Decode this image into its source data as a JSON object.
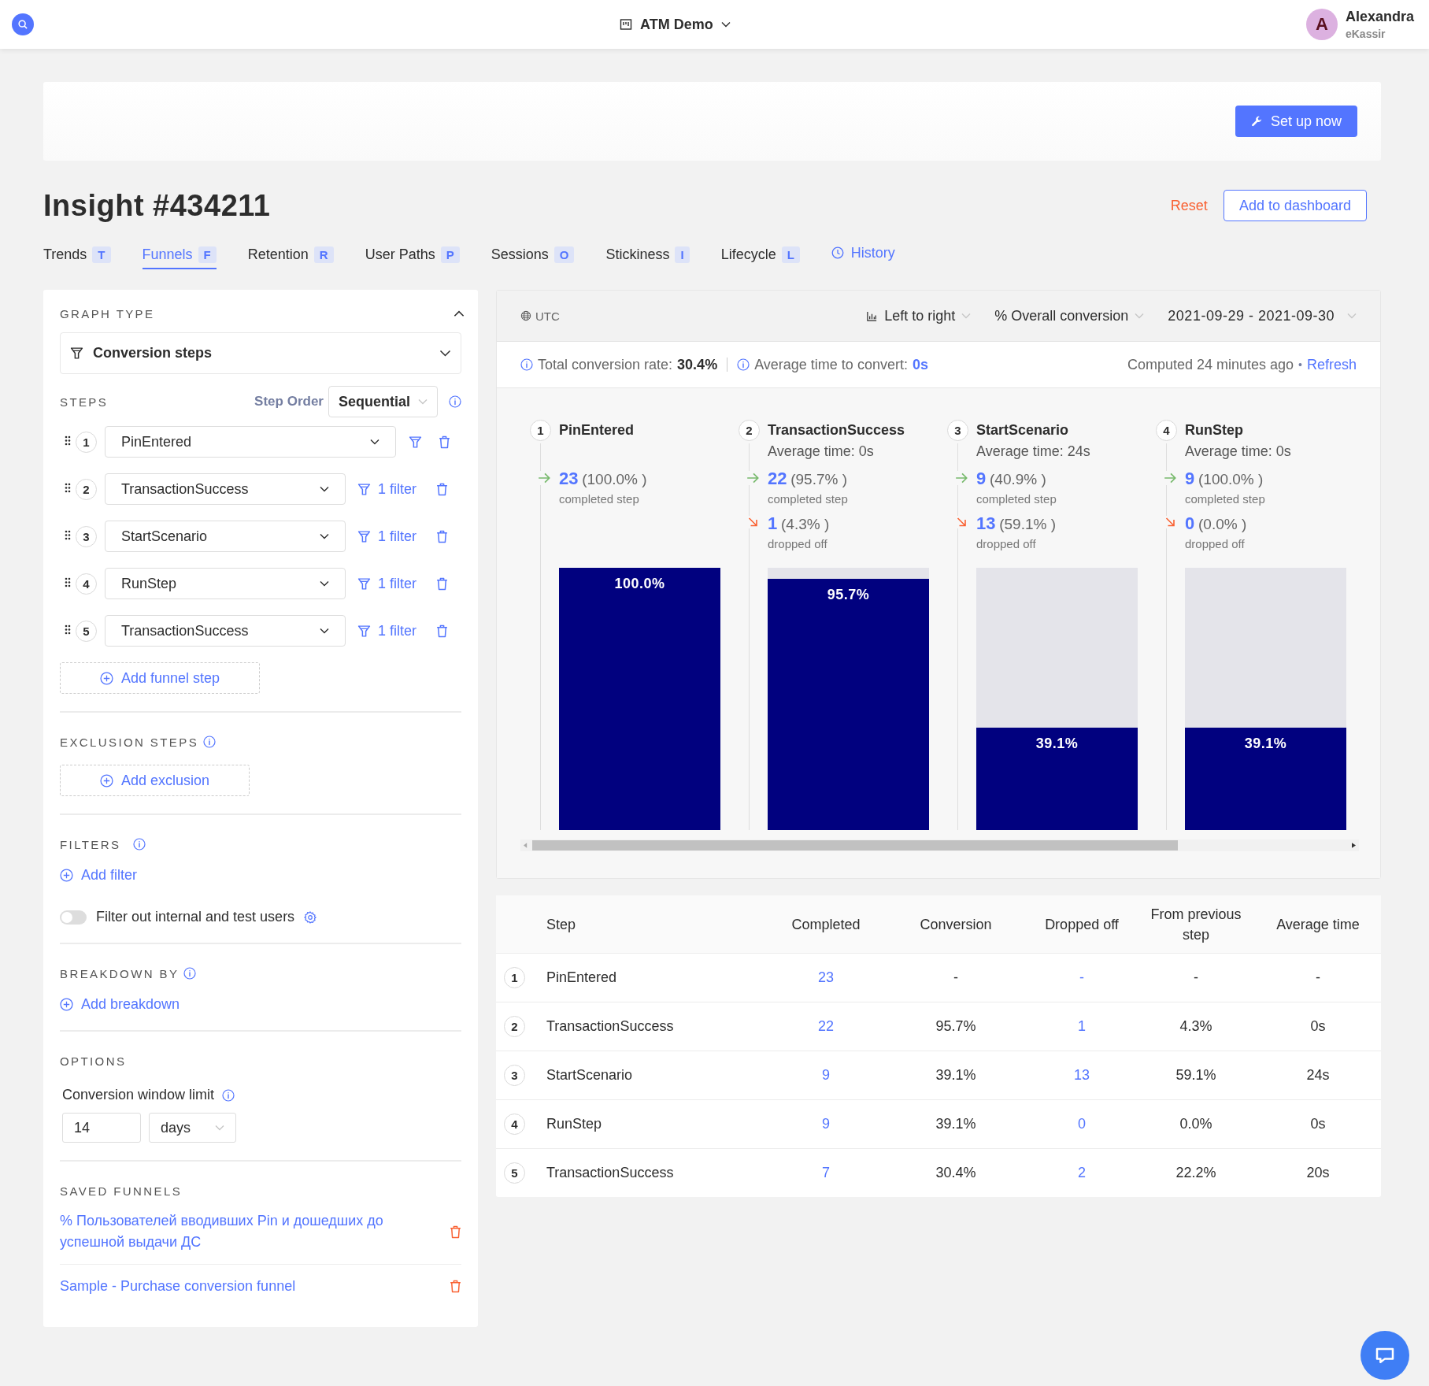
{
  "topbar": {
    "project": "ATM Demo",
    "user_initial": "A",
    "user_name": "Alexandra",
    "org": "eKassir"
  },
  "banner": {
    "button": "Set up now"
  },
  "insight": {
    "title": "Insight #434211",
    "reset": "Reset",
    "add_to_dashboard": "Add to dashboard"
  },
  "tabs": [
    {
      "label": "Trends",
      "key": "T",
      "selected": false
    },
    {
      "label": "Funnels",
      "key": "F",
      "selected": true
    },
    {
      "label": "Retention",
      "key": "R",
      "selected": false
    },
    {
      "label": "User Paths",
      "key": "P",
      "selected": false
    },
    {
      "label": "Sessions",
      "key": "O",
      "selected": false
    },
    {
      "label": "Stickiness",
      "key": "I",
      "selected": false
    },
    {
      "label": "Lifecycle",
      "key": "L",
      "selected": false
    }
  ],
  "history": "History",
  "left_panel": {
    "graph_type": {
      "heading": "GRAPH TYPE",
      "value": "Conversion steps"
    },
    "steps": {
      "heading": "STEPS",
      "order_label": "Step Order",
      "order_value": "Sequential",
      "items": [
        {
          "number": "1",
          "event": "PinEntered"
        },
        {
          "number": "2",
          "event": "TransactionSuccess",
          "filter": "1 filter"
        },
        {
          "number": "3",
          "event": "StartScenario",
          "filter": "1 filter"
        },
        {
          "number": "4",
          "event": "RunStep",
          "filter": "1 filter"
        },
        {
          "number": "5",
          "event": "TransactionSuccess",
          "filter": "1 filter"
        }
      ],
      "add": "Add funnel step"
    },
    "exclusion": {
      "heading": "EXCLUSION STEPS",
      "add": "Add exclusion"
    },
    "filters": {
      "heading": "FILTERS",
      "add": "Add filter",
      "toggle_label": "Filter out internal and test users",
      "toggle_on": false
    },
    "breakdown": {
      "heading": "BREAKDOWN BY",
      "add": "Add breakdown"
    },
    "options": {
      "heading": "OPTIONS",
      "window_label": "Conversion window limit",
      "window_value": "14",
      "window_unit": "days"
    },
    "saved": {
      "heading": "SAVED FUNNELS",
      "items": [
        "% Пользователей вводивших Pin и дошедших до успешной выдачи ДС",
        "Sample - Purchase conversion funnel"
      ]
    }
  },
  "controls": {
    "timezone": "UTC",
    "layout": "Left to right",
    "metric": "% Overall conversion",
    "date_range": "2021-09-29 - 2021-09-30"
  },
  "summary": {
    "total_label": "Total conversion rate:",
    "total_value": "30.4%",
    "avg_label": "Average time to convert:",
    "avg_value": "0s",
    "computed": "Computed 24 minutes ago",
    "separator": "•",
    "refresh": "Refresh"
  },
  "funnel": [
    {
      "number": "1",
      "name": "PinEntered",
      "completed": "23",
      "completed_pct": "(100.0% )",
      "completed_caption": "completed step",
      "bar_label": "100.0%",
      "level": 1
    },
    {
      "number": "2",
      "name": "TransactionSuccess",
      "avg_time": "Average time: 0s",
      "completed": "22",
      "completed_pct": "(95.7% )",
      "completed_caption": "completed step",
      "dropped": "1",
      "dropped_pct": "(4.3% )",
      "dropped_caption": "dropped off",
      "bar_label": "95.7%",
      "level": 0.957
    },
    {
      "number": "3",
      "name": "StartScenario",
      "avg_time": "Average time: 24s",
      "completed": "9",
      "completed_pct": "(40.9% )",
      "completed_caption": "completed step",
      "dropped": "13",
      "dropped_pct": "(59.1% )",
      "dropped_caption": "dropped off",
      "bar_label": "39.1%",
      "level": 0.391
    },
    {
      "number": "4",
      "name": "RunStep",
      "avg_time": "Average time: 0s",
      "completed": "9",
      "completed_pct": "(100.0% )",
      "completed_caption": "completed step",
      "dropped": "0",
      "dropped_pct": "(0.0% )",
      "dropped_caption": "dropped off",
      "bar_label": "39.1%",
      "level": 0.391
    }
  ],
  "table": {
    "columns": [
      "Step",
      "Completed",
      "Conversion",
      "Dropped off",
      "From previous step",
      "Average time"
    ],
    "rows": [
      {
        "number": "1",
        "step": "PinEntered",
        "completed": "23",
        "conversion": "-",
        "dropped": "-",
        "from_previous": "-",
        "average_time": "-"
      },
      {
        "number": "2",
        "step": "TransactionSuccess",
        "completed": "22",
        "conversion": "95.7%",
        "dropped": "1",
        "from_previous": "4.3%",
        "average_time": "0s"
      },
      {
        "number": "3",
        "step": "StartScenario",
        "completed": "9",
        "conversion": "39.1%",
        "dropped": "13",
        "from_previous": "59.1%",
        "average_time": "24s"
      },
      {
        "number": "4",
        "step": "RunStep",
        "completed": "9",
        "conversion": "39.1%",
        "dropped": "0",
        "from_previous": "0.0%",
        "average_time": "0s"
      },
      {
        "number": "5",
        "step": "TransactionSuccess",
        "completed": "7",
        "conversion": "30.4%",
        "dropped": "2",
        "from_previous": "22.2%",
        "average_time": "20s"
      }
    ]
  }
}
